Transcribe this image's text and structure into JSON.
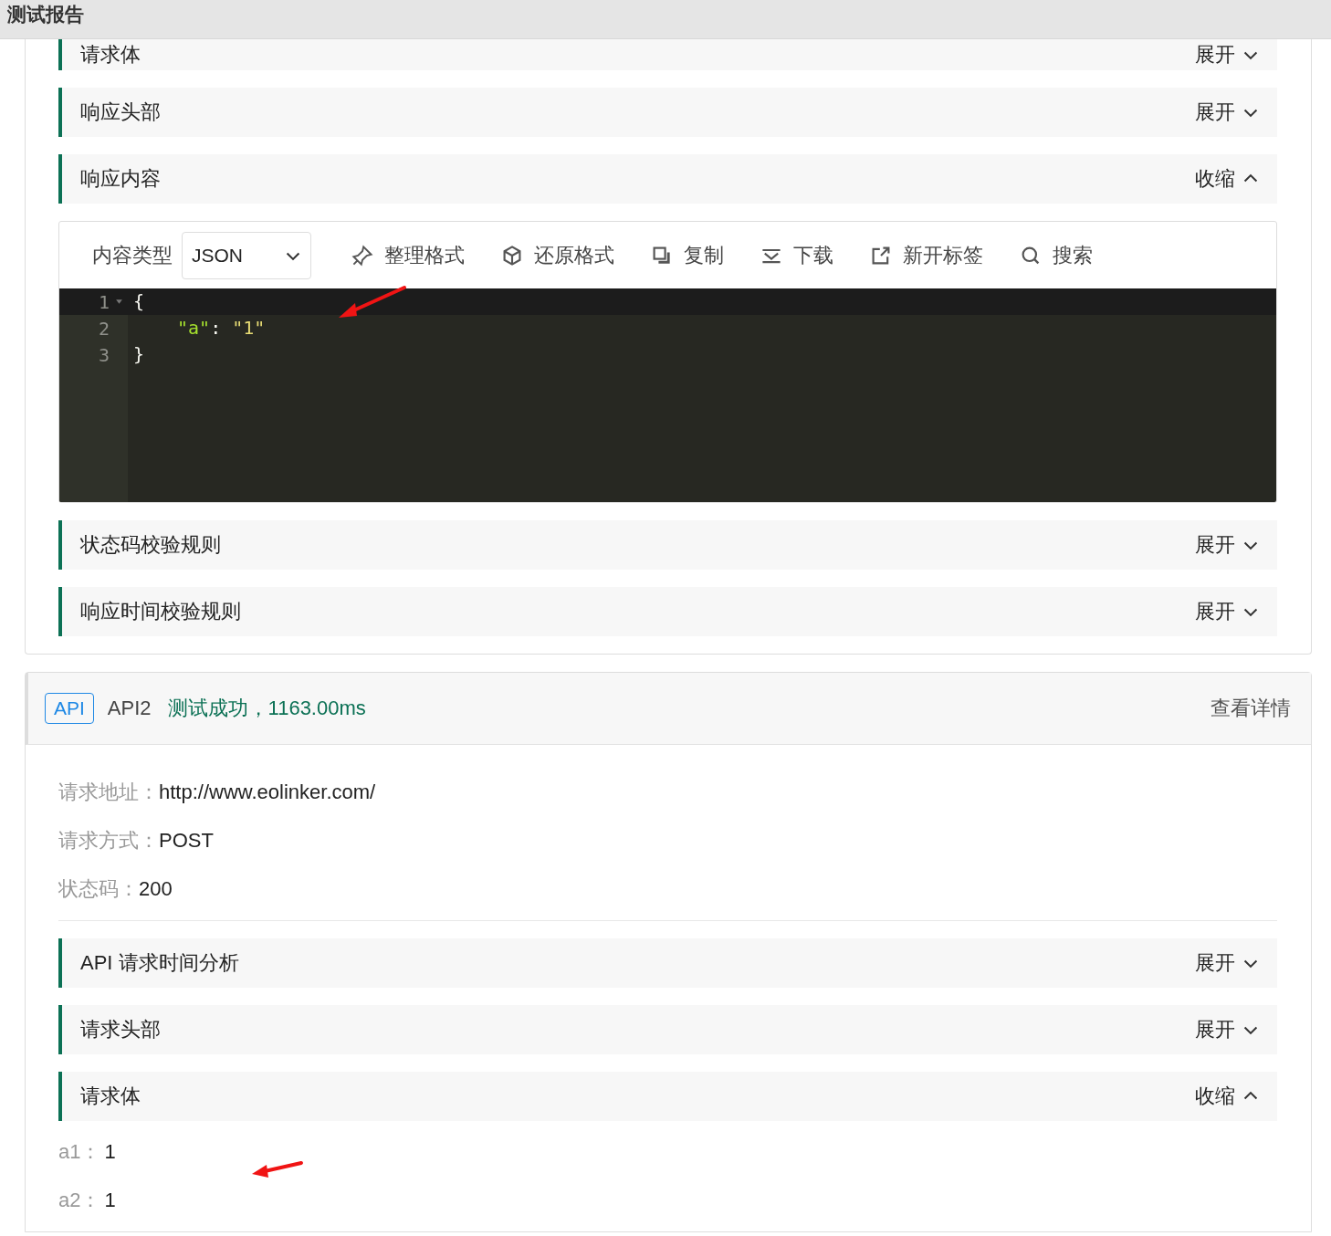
{
  "header": {
    "title": "测试报告"
  },
  "card1": {
    "panels_top": [
      {
        "title": "请求体",
        "action": "展开",
        "expanded": false
      },
      {
        "title": "响应头部",
        "action": "展开",
        "expanded": false
      },
      {
        "title": "响应内容",
        "action": "收缩",
        "expanded": true
      }
    ],
    "editor": {
      "content_type_label": "内容类型",
      "content_type": "JSON",
      "tools": [
        {
          "kind": "format",
          "label": "整理格式"
        },
        {
          "kind": "restore",
          "label": "还原格式"
        },
        {
          "kind": "copy",
          "label": "复制"
        },
        {
          "kind": "download",
          "label": "下载"
        },
        {
          "kind": "newtab",
          "label": "新开标签"
        },
        {
          "kind": "search",
          "label": "搜索"
        }
      ],
      "lines": [
        {
          "number": "1",
          "active": true,
          "foldable": true,
          "tokens": [
            {
              "kind": "punct",
              "text": "{"
            }
          ]
        },
        {
          "number": "2",
          "active": false,
          "foldable": false,
          "tokens": [
            {
              "kind": "key",
              "text": "\"a\""
            },
            {
              "kind": "plain",
              "text": ": "
            },
            {
              "kind": "string",
              "text": "\"1\""
            }
          ]
        },
        {
          "number": "3",
          "active": false,
          "foldable": false,
          "tokens": [
            {
              "kind": "punct",
              "text": "}"
            }
          ]
        }
      ]
    },
    "panels_bottom": [
      {
        "title": "状态码校验规则",
        "action": "展开",
        "expanded": false
      },
      {
        "title": "响应时间校验规则",
        "action": "展开",
        "expanded": false
      }
    ]
  },
  "card2": {
    "tag": "API",
    "name": "API2",
    "status": "测试成功，1163.00ms",
    "details_link": "查看详情",
    "info": [
      {
        "label": "请求地址：",
        "value": "http://www.eolinker.com/"
      },
      {
        "label": "请求方式：",
        "value": "POST"
      },
      {
        "label": "状态码：",
        "value": "200"
      }
    ],
    "panels": [
      {
        "title": "API 请求时间分析",
        "action": "展开",
        "expanded": false
      },
      {
        "title": "请求头部",
        "action": "展开",
        "expanded": false
      },
      {
        "title": "请求体",
        "action": "收缩",
        "expanded": true
      }
    ],
    "params": [
      {
        "label": "a1：",
        "value": "1"
      },
      {
        "label": "a2：",
        "value": "1"
      }
    ]
  }
}
